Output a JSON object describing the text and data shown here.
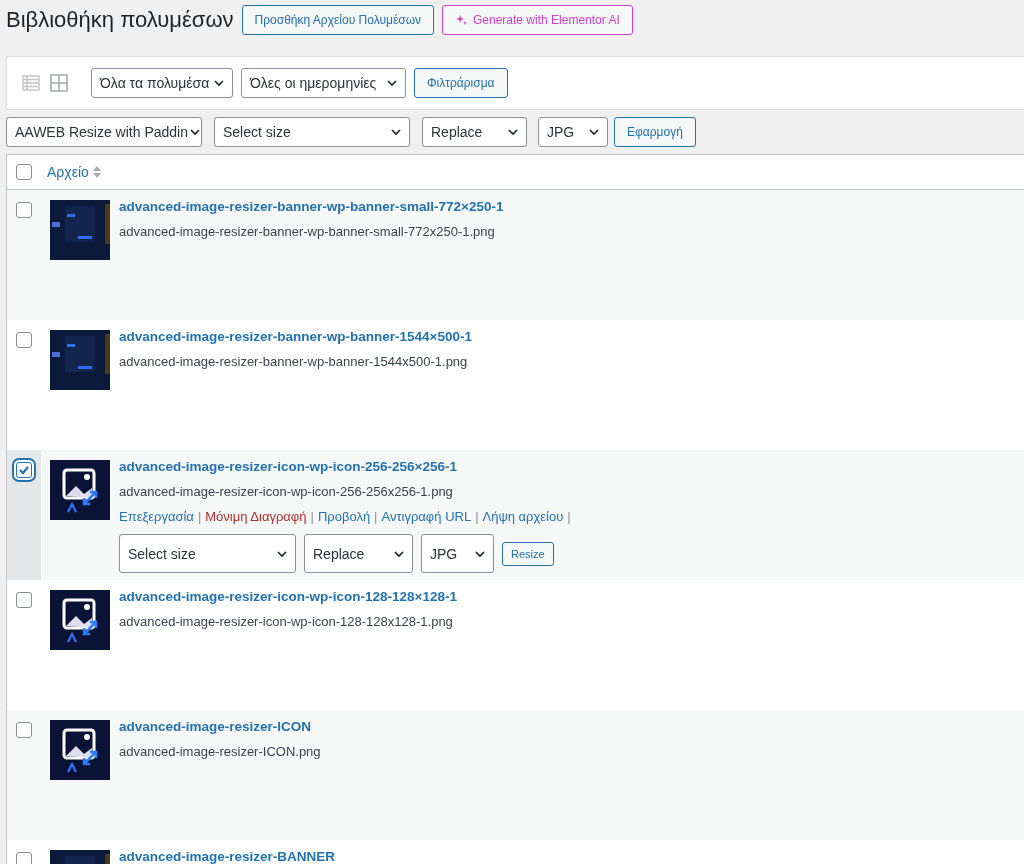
{
  "header": {
    "title": "Βιβλιοθήκη πολυμέσων",
    "add_button": "Προσθήκη Αρχείου Πολυμέσων",
    "ai_button": "Generate with Elementor AI"
  },
  "filters": {
    "view_modes": [
      {
        "kind": "list",
        "selected": true
      },
      {
        "kind": "grid",
        "selected": false
      }
    ],
    "type_select": "Όλα τα πολυμέσα",
    "date_select": "Όλες οι ημερομηνίες",
    "filter_button": "Φιλτράρισμα"
  },
  "bulk": {
    "action_select": "AAWEB Resize with Paddin",
    "size_select": "Select size",
    "mode_select": "Replace",
    "format_select": "JPG",
    "apply_button": "Εφαρμογή"
  },
  "table": {
    "select_all_checked": false,
    "columns": [
      {
        "label": "Αρχείο",
        "sortable": true
      }
    ],
    "rows": [
      {
        "title": "advanced-image-resizer-banner-wp-banner-small-772×250-1",
        "filename": "advanced-image-resizer-banner-wp-banner-small-772x250-1.png",
        "kind": "banner",
        "checked": false
      },
      {
        "title": "advanced-image-resizer-banner-wp-banner-1544×500-1",
        "filename": "advanced-image-resizer-banner-wp-banner-1544x500-1.png",
        "kind": "banner",
        "checked": false
      },
      {
        "title": "advanced-image-resizer-icon-wp-icon-256-256×256-1",
        "filename": "advanced-image-resizer-icon-wp-icon-256-256x256-1.png",
        "kind": "icon",
        "checked": true,
        "actions": [
          {
            "label": "Επεξεργασία",
            "kind": "link",
            "separator": "|"
          },
          {
            "label": "Μόνιμη Διαγραφή",
            "kind": "delete",
            "separator": "|"
          },
          {
            "label": "Προβολή",
            "kind": "link",
            "separator": "|"
          },
          {
            "label": "Αντιγραφή URL",
            "kind": "link",
            "separator": "|"
          },
          {
            "label": "Λήψη αρχείου",
            "kind": "link",
            "separator": "|"
          }
        ],
        "controls": {
          "size_select": "Select size",
          "mode_select": "Replace",
          "format_select": "JPG",
          "resize_button": "Resize"
        }
      },
      {
        "title": "advanced-image-resizer-icon-wp-icon-128-128×128-1",
        "filename": "advanced-image-resizer-icon-wp-icon-128-128x128-1.png",
        "kind": "icon",
        "checked": false
      },
      {
        "title": "advanced-image-resizer-ICON",
        "filename": "advanced-image-resizer-ICON.png",
        "kind": "icon",
        "checked": false
      },
      {
        "title": "advanced-image-resizer-BANNER",
        "kind": "banner",
        "checked": false
      }
    ]
  }
}
